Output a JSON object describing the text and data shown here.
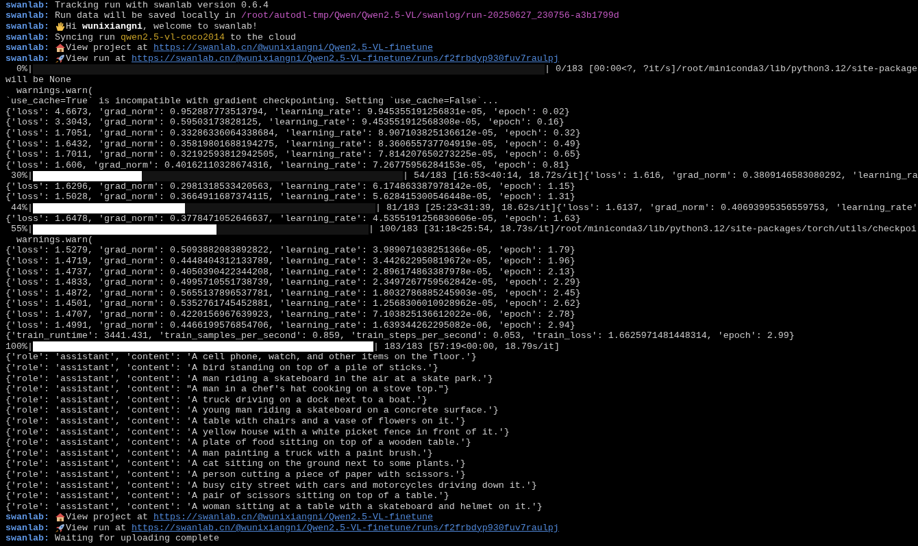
{
  "terminal": {
    "lines": [
      {
        "kind": "swanlab",
        "prefix": "swanlab:",
        "parts": [
          {
            "kind": "text",
            "text": " Tracking run with swanlab version 0.6.4"
          }
        ]
      },
      {
        "kind": "swanlab",
        "prefix": "swanlab:",
        "parts": [
          {
            "kind": "text",
            "text": " Run data will be saved locally in "
          },
          {
            "kind": "path",
            "text": "/root/autodl-tmp/Qwen/Qwen2.5-VL/swanlog/run-20250627_230756-a3b1799d"
          }
        ]
      },
      {
        "kind": "swanlab",
        "prefix": "swanlab:",
        "parts": [
          {
            "kind": "hand"
          },
          {
            "kind": "text",
            "text": "Hi "
          },
          {
            "kind": "strong",
            "text": "wunixiangni"
          },
          {
            "kind": "text",
            "text": ", welcome to swanlab!"
          }
        ]
      },
      {
        "kind": "swanlab",
        "prefix": "swanlab:",
        "parts": [
          {
            "kind": "text",
            "text": " Syncing run "
          },
          {
            "kind": "project",
            "text": "qwen2.5-vl-coco2014"
          },
          {
            "kind": "text",
            "text": " to the cloud"
          }
        ]
      },
      {
        "kind": "swanlab",
        "prefix": "swanlab:",
        "parts": [
          {
            "kind": "house"
          },
          {
            "kind": "text",
            "text": "View project at "
          },
          {
            "kind": "link",
            "text": "https://swanlab.cn/@wunixiangni/Qwen2.5-VL-finetune"
          }
        ]
      },
      {
        "kind": "swanlab",
        "prefix": "swanlab:",
        "parts": [
          {
            "kind": "rocket"
          },
          {
            "kind": "text",
            "text": "View run at "
          },
          {
            "kind": "link",
            "text": "https://swanlab.cn/@wunixiangni/Qwen2.5-VL-finetune/runs/f2frbdyp930fuv7raulpj"
          }
        ]
      },
      {
        "kind": "progress",
        "percent": "  0%|",
        "level": 0,
        "status": "| 0/183 [00:00<?, ?it/s]/root/miniconda3/lib/python3.12/site-package"
      },
      {
        "kind": "text",
        "text": "will be None"
      },
      {
        "kind": "text",
        "text": "  warnings.warn("
      },
      {
        "kind": "text",
        "text": "`use_cache=True` is incompatible with gradient checkpointing. Setting `use_cache=False`..."
      },
      {
        "kind": "text",
        "text": "{'loss': 4.6673, 'grad_norm': 0.952887773513794, 'learning_rate': 9.945355191256831e-05, 'epoch': 0.02}"
      },
      {
        "kind": "text",
        "text": "{'loss': 3.3043, 'grad_norm': 0.59503173828125, 'learning_rate': 9.453551912568308e-05, 'epoch': 0.16}"
      },
      {
        "kind": "text",
        "text": "{'loss': 1.7051, 'grad_norm': 0.33286336064338684, 'learning_rate': 8.907103825136612e-05, 'epoch': 0.32}"
      },
      {
        "kind": "text",
        "text": "{'loss': 1.6432, 'grad_norm': 0.35819801688194275, 'learning_rate': 8.360655737704919e-05, 'epoch': 0.49}"
      },
      {
        "kind": "text",
        "text": "{'loss': 1.7011, 'grad_norm': 0.32192593812942505, 'learning_rate': 7.814207650273225e-05, 'epoch': 0.65}"
      },
      {
        "kind": "text",
        "text": "{'loss': 1.606, 'grad_norm': 0.40162110328674316, 'learning_rate': 7.26775956284153e-05, 'epoch': 0.81}"
      },
      {
        "kind": "progress",
        "percent": " 30%|",
        "level": 0.295,
        "status": "| 54/183 [16:53<40:14, 18.72s/it]{'loss': 1.616, 'grad_norm': 0.3809146583080292, 'learning_ra"
      },
      {
        "kind": "text",
        "text": "{'loss': 1.6296, 'grad_norm': 0.2981318533420563, 'learning_rate': 6.174863387978142e-05, 'epoch': 1.15}"
      },
      {
        "kind": "text",
        "text": "{'loss': 1.5028, 'grad_norm': 0.3664911687374115, 'learning_rate': 5.628415300546448e-05, 'epoch': 1.31}"
      },
      {
        "kind": "progress",
        "percent": " 44%|",
        "level": 0.443,
        "status": "| 81/183 [25:23<31:39, 18.62s/it]{'loss': 1.6137, 'grad_norm': 0.40693995356559753, 'learning_rate'"
      },
      {
        "kind": "text",
        "text": "{'loss': 1.6478, 'grad_norm': 0.3778471052646637, 'learning_rate': 4.5355191256830606e-05, 'epoch': 1.63}"
      },
      {
        "kind": "progress",
        "percent": " 55%|",
        "level": 0.546,
        "status": "| 100/183 [31:18<25:54, 18.73s/it]/root/miniconda3/lib/python3.12/site-packages/torch/utils/checkpoi"
      },
      {
        "kind": "text",
        "text": "  warnings.warn("
      },
      {
        "kind": "text",
        "text": "{'loss': 1.5279, 'grad_norm': 0.5093882083892822, 'learning_rate': 3.989071038251366e-05, 'epoch': 1.79}"
      },
      {
        "kind": "text",
        "text": "{'loss': 1.4719, 'grad_norm': 0.4448404312133789, 'learning_rate': 3.442622950819672e-05, 'epoch': 1.96}"
      },
      {
        "kind": "text",
        "text": "{'loss': 1.4737, 'grad_norm': 0.4050390422344208, 'learning_rate': 2.896174863387978e-05, 'epoch': 2.13}"
      },
      {
        "kind": "text",
        "text": "{'loss': 1.4833, 'grad_norm': 0.4995710551738739, 'learning_rate': 2.3497267759562842e-05, 'epoch': 2.29}"
      },
      {
        "kind": "text",
        "text": "{'loss': 1.4872, 'grad_norm': 0.5655137896537781, 'learning_rate': 1.8032786885245903e-05, 'epoch': 2.45}"
      },
      {
        "kind": "text",
        "text": "{'loss': 1.4501, 'grad_norm': 0.5352761745452881, 'learning_rate': 1.2568306010928962e-05, 'epoch': 2.62}"
      },
      {
        "kind": "text",
        "text": "{'loss': 1.4707, 'grad_norm': 0.4220156967639923, 'learning_rate': 7.103825136612022e-06, 'epoch': 2.78}"
      },
      {
        "kind": "text",
        "text": "{'loss': 1.4991, 'grad_norm': 0.4466199576854706, 'learning_rate': 1.639344262295082e-06, 'epoch': 2.94}"
      },
      {
        "kind": "text",
        "text": "{'train_runtime': 3441.431, 'train_samples_per_second': 0.859, 'train_steps_per_second': 0.053, 'train_loss': 1.6625971481448314, 'epoch': 2.99}"
      },
      {
        "kind": "progress",
        "percent": "100%|",
        "level": 1,
        "status": "| 183/183 [57:19<00:00, 18.79s/it]"
      },
      {
        "kind": "text",
        "text": "{'role': 'assistant', 'content': 'A cell phone, watch, and other items on the floor.'}"
      },
      {
        "kind": "text",
        "text": "{'role': 'assistant', 'content': 'A bird standing on top of a pile of sticks.'}"
      },
      {
        "kind": "text",
        "text": "{'role': 'assistant', 'content': 'A man riding a skateboard in the air at a skate park.'}"
      },
      {
        "kind": "text",
        "text": "{'role': 'assistant', 'content': \"A man in a chef's hat cooking on a stove top.\"}"
      },
      {
        "kind": "text",
        "text": "{'role': 'assistant', 'content': 'A truck driving on a dock next to a boat.'}"
      },
      {
        "kind": "text",
        "text": "{'role': 'assistant', 'content': 'A young man riding a skateboard on a concrete surface.'}"
      },
      {
        "kind": "text",
        "text": "{'role': 'assistant', 'content': 'A table with chairs and a vase of flowers on it.'}"
      },
      {
        "kind": "text",
        "text": "{'role': 'assistant', 'content': 'A yellow house with a white picket fence in front of it.'}"
      },
      {
        "kind": "text",
        "text": "{'role': 'assistant', 'content': 'A plate of food sitting on top of a wooden table.'}"
      },
      {
        "kind": "text",
        "text": "{'role': 'assistant', 'content': 'A man painting a truck with a paint brush.'}"
      },
      {
        "kind": "text",
        "text": "{'role': 'assistant', 'content': 'A cat sitting on the ground next to some plants.'}"
      },
      {
        "kind": "text",
        "text": "{'role': 'assistant', 'content': 'A person cutting a piece of paper with scissors.'}"
      },
      {
        "kind": "text",
        "text": "{'role': 'assistant', 'content': 'A busy city street with cars and motorcycles driving down it.'}"
      },
      {
        "kind": "text",
        "text": "{'role': 'assistant', 'content': 'A pair of scissors sitting on top of a table.'}"
      },
      {
        "kind": "text",
        "text": "{'role': 'assistant', 'content': 'A woman sitting at a table with a skateboard and helmet on it.'}"
      },
      {
        "kind": "swanlab",
        "prefix": "swanlab:",
        "parts": [
          {
            "kind": "house"
          },
          {
            "kind": "text",
            "text": "View project at "
          },
          {
            "kind": "link",
            "text": "https://swanlab.cn/@wunixiangni/Qwen2.5-VL-finetune"
          }
        ]
      },
      {
        "kind": "swanlab",
        "prefix": "swanlab:",
        "parts": [
          {
            "kind": "rocket"
          },
          {
            "kind": "text",
            "text": "View run at "
          },
          {
            "kind": "link",
            "text": "https://swanlab.cn/@wunixiangni/Qwen2.5-VL-finetune/runs/f2frbdyp930fuv7raulpj"
          }
        ]
      },
      {
        "kind": "swanlab",
        "prefix": "swanlab:",
        "parts": [
          {
            "kind": "text",
            "text": " Waiting for uploading complete"
          }
        ]
      }
    ]
  }
}
